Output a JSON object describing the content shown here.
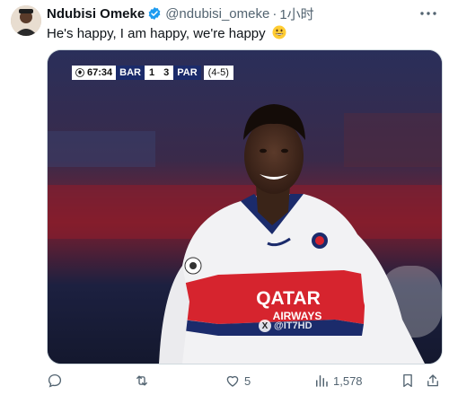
{
  "tweet": {
    "author_name": "Ndubisi Omeke",
    "handle": "@ndubisi_omeke",
    "separator": "·",
    "time": "1小时",
    "text": "He's happy, I am happy, we're happy",
    "emoji": "grinning-face-emoji",
    "verified": true
  },
  "media": {
    "scorebug": {
      "clock": "67:34",
      "home": "BAR",
      "home_score": "1",
      "away_score": "3",
      "away": "PAR",
      "aggregate": "(4-5)"
    },
    "jersey_text": [
      "QATAR",
      "AIRWAYS"
    ],
    "watermark": "@IT7HD"
  },
  "actions": {
    "reply_count": "",
    "retweet_count": "",
    "like_count": "5",
    "views_count": "1,578"
  },
  "colors": {
    "accent": "#1d9bf0",
    "muted": "#536471",
    "jersey_red": "#d6242e",
    "scorebug_navy": "#1b2b6b"
  }
}
